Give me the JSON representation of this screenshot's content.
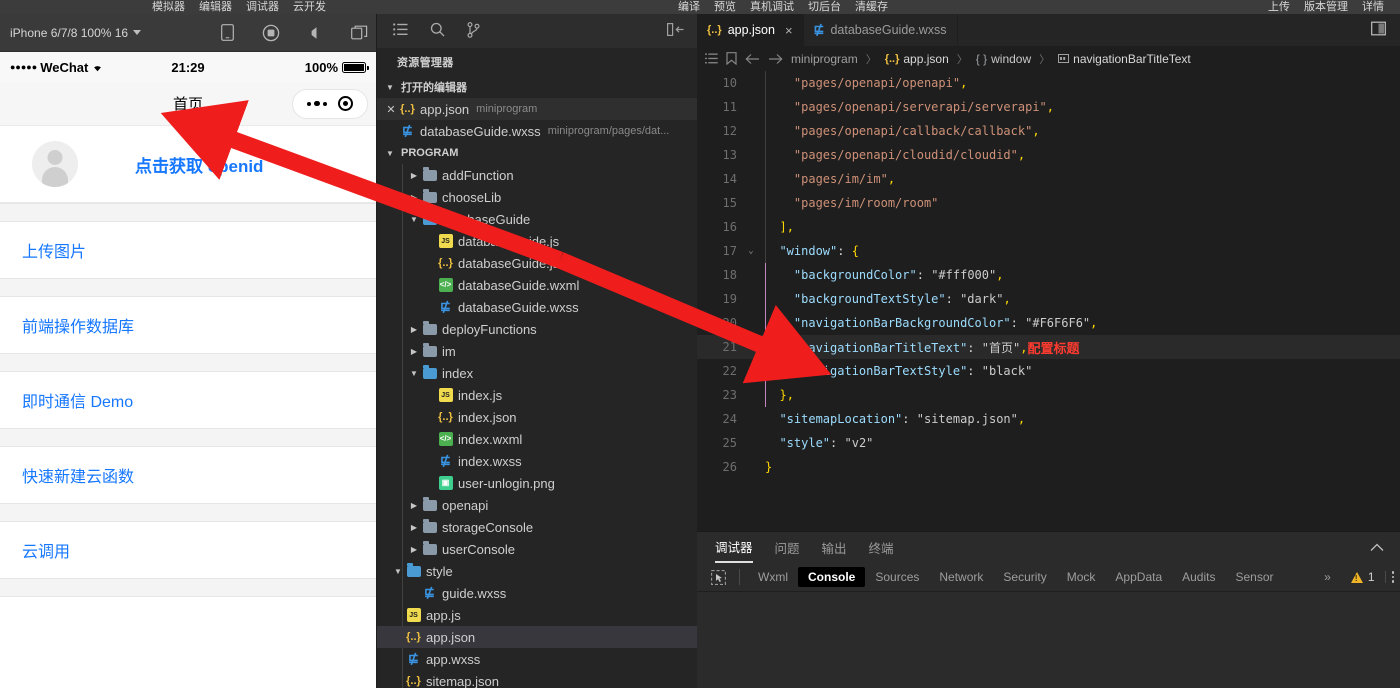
{
  "topbar": {
    "left_group": [
      "模拟器",
      "编辑器",
      "调试器",
      "云开发"
    ],
    "mid_group": [
      "编译",
      "预览",
      "真机调试",
      "切后台",
      "清缓存"
    ],
    "right_group": [
      "上传",
      "版本管理",
      "详情"
    ]
  },
  "simulator": {
    "device_label": "iPhone 6/7/8 100% 16",
    "icons": [
      "phone-rotate-icon",
      "record-icon",
      "sound-icon",
      "multi-window-icon"
    ],
    "status_bar": {
      "carrier_dots": "●●●●●",
      "carrier": "WeChat",
      "wifi": "wifi-icon",
      "time": "21:29",
      "battery_percent": "100%"
    },
    "nav_title": "首页",
    "profile": {
      "avatar": "user-avatar-icon",
      "link_label": "点击获取 openid"
    },
    "cells": [
      "上传图片",
      "前端操作数据库",
      "即时通信 Demo",
      "快速新建云函数",
      "云调用"
    ]
  },
  "explorer": {
    "actions": [
      "list-icon",
      "search-icon",
      "source-control-icon"
    ],
    "collapse_icon": "collapse-panel-icon",
    "title": "资源管理器",
    "open_editors": {
      "label": "打开的编辑器",
      "items": [
        {
          "name": "app.json",
          "desc": "miniprogram",
          "icon": "json-file-icon",
          "closable": true,
          "active": true
        },
        {
          "name": "databaseGuide.wxss",
          "desc": "miniprogram/pages/dat...",
          "icon": "wxss-file-icon",
          "closable": false,
          "active": false
        }
      ]
    },
    "program": {
      "label": "PROGRAM",
      "tree": [
        {
          "name": "addFunction",
          "type": "folder",
          "depth": 1,
          "expanded": false
        },
        {
          "name": "chooseLib",
          "type": "folder",
          "depth": 1,
          "expanded": false
        },
        {
          "name": "databaseGuide",
          "type": "folder",
          "depth": 1,
          "expanded": true
        },
        {
          "name": "databaseGuide.js",
          "type": "js",
          "depth": 2
        },
        {
          "name": "databaseGuide.json",
          "type": "json",
          "depth": 2
        },
        {
          "name": "databaseGuide.wxml",
          "type": "wxml",
          "depth": 2
        },
        {
          "name": "databaseGuide.wxss",
          "type": "wxss",
          "depth": 2
        },
        {
          "name": "deployFunctions",
          "type": "folder",
          "depth": 1,
          "expanded": false
        },
        {
          "name": "im",
          "type": "folder",
          "depth": 1,
          "expanded": false
        },
        {
          "name": "index",
          "type": "folder",
          "depth": 1,
          "expanded": true
        },
        {
          "name": "index.js",
          "type": "js",
          "depth": 2
        },
        {
          "name": "index.json",
          "type": "json",
          "depth": 2
        },
        {
          "name": "index.wxml",
          "type": "wxml",
          "depth": 2
        },
        {
          "name": "index.wxss",
          "type": "wxss",
          "depth": 2
        },
        {
          "name": "user-unlogin.png",
          "type": "png",
          "depth": 2
        },
        {
          "name": "openapi",
          "type": "folder",
          "depth": 1,
          "expanded": false
        },
        {
          "name": "storageConsole",
          "type": "folder",
          "depth": 1,
          "expanded": false
        },
        {
          "name": "userConsole",
          "type": "folder",
          "depth": 1,
          "expanded": false
        },
        {
          "name": "style",
          "type": "folder",
          "depth": 0,
          "expanded": true
        },
        {
          "name": "guide.wxss",
          "type": "wxss",
          "depth": 1
        },
        {
          "name": "app.js",
          "type": "js",
          "depth": 0
        },
        {
          "name": "app.json",
          "type": "json",
          "depth": 0,
          "selected": true
        },
        {
          "name": "app.wxss",
          "type": "wxss",
          "depth": 0
        },
        {
          "name": "sitemap.json",
          "type": "json",
          "depth": 0
        }
      ]
    }
  },
  "editor": {
    "tabs": [
      {
        "label": "app.json",
        "icon": "json-file-icon",
        "active": true,
        "close": "×"
      },
      {
        "label": "databaseGuide.wxss",
        "icon": "wxss-file-icon",
        "active": false
      }
    ],
    "layout_icon": "split-editor-icon",
    "breadcrumb": {
      "icons": [
        "outline-icon",
        "bookmark-icon",
        "back-arrow-icon",
        "forward-arrow-icon"
      ],
      "segments": [
        "miniprogram",
        "app.json",
        "window",
        "navigationBarTitleText"
      ],
      "separator": "〉"
    },
    "code_lines": [
      {
        "num": 10,
        "indent": 4,
        "text": "\"pages/openapi/openapi\",",
        "fold": ""
      },
      {
        "num": 11,
        "indent": 4,
        "text": "\"pages/openapi/serverapi/serverapi\",",
        "fold": ""
      },
      {
        "num": 12,
        "indent": 4,
        "text": "\"pages/openapi/callback/callback\",",
        "fold": ""
      },
      {
        "num": 13,
        "indent": 4,
        "text": "\"pages/openapi/cloudid/cloudid\",",
        "fold": ""
      },
      {
        "num": 14,
        "indent": 4,
        "text": "\"pages/im/im\",",
        "fold": ""
      },
      {
        "num": 15,
        "indent": 4,
        "text": "\"pages/im/room/room\"",
        "fold": ""
      },
      {
        "num": 16,
        "indent": 2,
        "text": "],",
        "fold": ""
      },
      {
        "num": 17,
        "indent": 2,
        "text": "\"window\": {",
        "fold": "v"
      },
      {
        "num": 18,
        "indent": 4,
        "text": "\"backgroundColor\": \"#fff000\",",
        "fold": ""
      },
      {
        "num": 19,
        "indent": 4,
        "text": "\"backgroundTextStyle\": \"dark\",",
        "fold": ""
      },
      {
        "num": 20,
        "indent": 4,
        "text": "\"navigationBarBackgroundColor\": \"#F6F6F6\",",
        "fold": ""
      },
      {
        "num": 21,
        "indent": 4,
        "text": "\"navigationBarTitleText\": \"首页\",",
        "fold": "",
        "highlight": true,
        "annotation": "配置标题"
      },
      {
        "num": 22,
        "indent": 4,
        "text": "\"navigationBarTextStyle\": \"black\"",
        "fold": ""
      },
      {
        "num": 23,
        "indent": 2,
        "text": "},",
        "fold": ""
      },
      {
        "num": 24,
        "indent": 2,
        "text": "\"sitemapLocation\": \"sitemap.json\",",
        "fold": ""
      },
      {
        "num": 25,
        "indent": 2,
        "text": "\"style\": \"v2\"",
        "fold": ""
      },
      {
        "num": 26,
        "indent": 0,
        "text": "}",
        "fold": ""
      }
    ]
  },
  "debugger": {
    "panel_tabs": [
      "调试器",
      "问题",
      "输出",
      "终端"
    ],
    "panel_tab_active": "调试器",
    "collapse_icon": "chevron-up-icon",
    "devtool_select_icon": "inspect-element-icon",
    "devtool_tabs": [
      "Wxml",
      "Console",
      "Sources",
      "Network",
      "Security",
      "Mock",
      "AppData",
      "Audits",
      "Sensor"
    ],
    "devtool_tab_active": "Console",
    "more_icon": "»",
    "warning_count": "1",
    "kebab_icon": "more-options-icon"
  },
  "annotations": {
    "arrow_color": "#f01d1d",
    "arrow_count": 2
  }
}
